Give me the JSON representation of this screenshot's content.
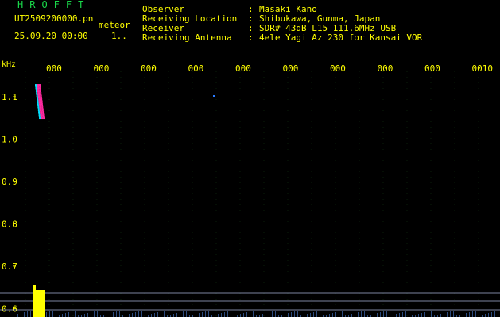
{
  "header": {
    "app_title": "HROFFT",
    "filename": "UT2509200000.pn",
    "event_label": "meteor",
    "datetime": "25.09.20 00:00",
    "count": "1..",
    "info": [
      {
        "label": "Observer",
        "value": "Masaki Kano"
      },
      {
        "label": "Receiving Location",
        "value": "Shibukawa, Gunma, Japan"
      },
      {
        "label": "Receiver",
        "value": "SDR# 43dB L15 111.6MHz USB"
      },
      {
        "label": "Receiving Antenna",
        "value": "4ele Yagi Az 230 for Kansai VOR"
      }
    ]
  },
  "chart_data": {
    "type": "heatmap",
    "ylabel": "kHz",
    "y_ticks": [
      "1.1",
      "1.0",
      "0.9",
      "0.8",
      "0.7",
      "0.6"
    ],
    "x_ticks": [
      "000",
      "000",
      "000",
      "000",
      "000",
      "000",
      "000",
      "000",
      "000",
      "0010"
    ],
    "ylim": [
      0.58,
      1.16
    ],
    "echo": {
      "time_fraction": 0.08,
      "freq_low": 1.05,
      "freq_high": 1.13
    },
    "background_color": "#000000",
    "grid_color": "#143c14",
    "label_color": "#ffff00",
    "echo_colors": [
      "#ff2aa0",
      "#2a7bff",
      "#00e0ff"
    ]
  }
}
